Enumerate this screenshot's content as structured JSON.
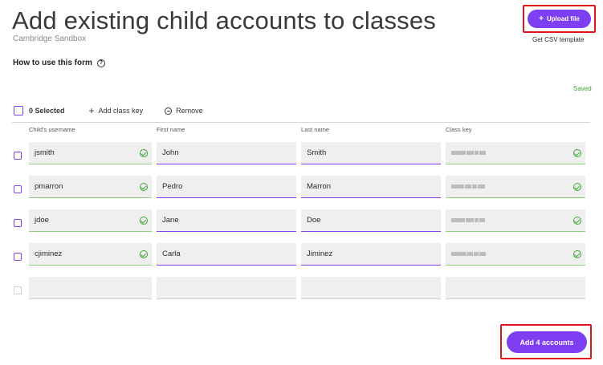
{
  "header": {
    "title": "Add existing child accounts to classes",
    "subtitle": "Cambridge Sandbox",
    "upload_label": "Upload file",
    "csv_template_label": "Get CSV template"
  },
  "help": {
    "label": "How to use this form",
    "icon": "question-circle-icon"
  },
  "status": {
    "saved_label": "Saved",
    "color": "#3aa735"
  },
  "toolbar": {
    "selected_label": "0 Selected",
    "add_class_key_label": "Add class key",
    "remove_label": "Remove"
  },
  "columns": [
    "Child's username",
    "First name",
    "Last name",
    "Class key"
  ],
  "rows": [
    {
      "username": "jsmith",
      "first": "John",
      "last": "Smith"
    },
    {
      "username": "pmarron",
      "first": "Pedro",
      "last": "Marron"
    },
    {
      "username": "jdoe",
      "first": "Jane",
      "last": "Doe"
    },
    {
      "username": "cjiminez",
      "first": "Carla",
      "last": "Jiminez"
    },
    {
      "username": "",
      "first": "",
      "last": ""
    }
  ],
  "footer": {
    "add_label": "Add 4 accounts"
  },
  "colors": {
    "accent": "#7e3ff2",
    "valid": "#8bd17c",
    "highlight_box": "#e0141c"
  }
}
